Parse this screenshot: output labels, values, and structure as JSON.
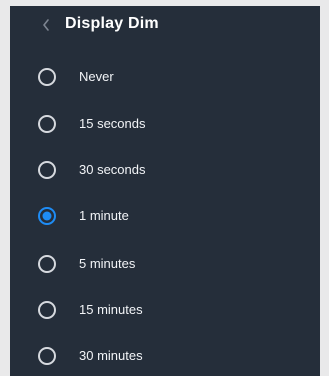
{
  "colors": {
    "panel_bg": "#252e3a",
    "page_bg": "#e9e9ea",
    "text": "#f2f4f7",
    "radio_off": "#d6d9de",
    "radio_on": "#1e8cf5"
  },
  "header": {
    "back_icon": "chevron-left-icon",
    "title": "Display Dim"
  },
  "options": [
    {
      "label": "Never",
      "selected": false
    },
    {
      "label": "15 seconds",
      "selected": false
    },
    {
      "label": "30 seconds",
      "selected": false
    },
    {
      "label": "1 minute",
      "selected": true
    },
    {
      "label": "5 minutes",
      "selected": false
    },
    {
      "label": "15 minutes",
      "selected": false
    },
    {
      "label": "30 minutes",
      "selected": false
    }
  ]
}
